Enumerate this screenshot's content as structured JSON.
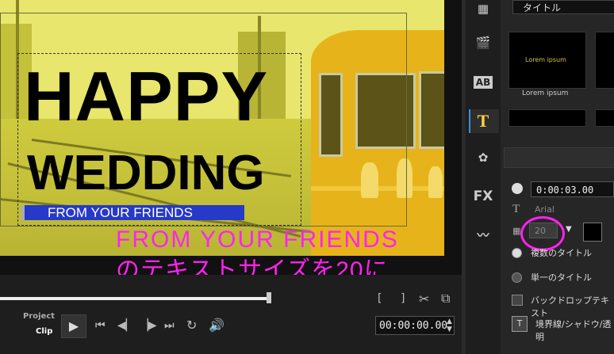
{
  "preview": {
    "title_lines": [
      "HAPPY",
      "WEDDING"
    ],
    "subtitle": "FROM YOUR FRIENDS",
    "annotation_lines": [
      "FROM YOUR FRIENDS",
      "のテキストサイズを20に"
    ],
    "annotation_color": "#ff22ee",
    "title_bar_color": "#2639c8"
  },
  "transport": {
    "mode_project": "Project",
    "mode_clip": "Clip",
    "timecode": "00:00:00.00",
    "progress_fraction": 0.58
  },
  "right_panel": {
    "category": "タイトル",
    "thumbnails": [
      {
        "preview_text": "Lorem ipsum",
        "label": "Lorem ipsum"
      }
    ],
    "duration": "0:00:03.00",
    "font_name": "Arial",
    "font_size": "20",
    "font_color": "#000000",
    "option_multi": "複数のタイトル",
    "option_single": "単一のタイトル",
    "backdrop": "バックドロップテキスト",
    "border_shadow": "境界線/シャドウ/透明",
    "tools": [
      "media-icon",
      "instant-project-icon",
      "transition-icon",
      "title-icon",
      "graphic-icon",
      "fx-icon",
      "path-icon"
    ]
  }
}
